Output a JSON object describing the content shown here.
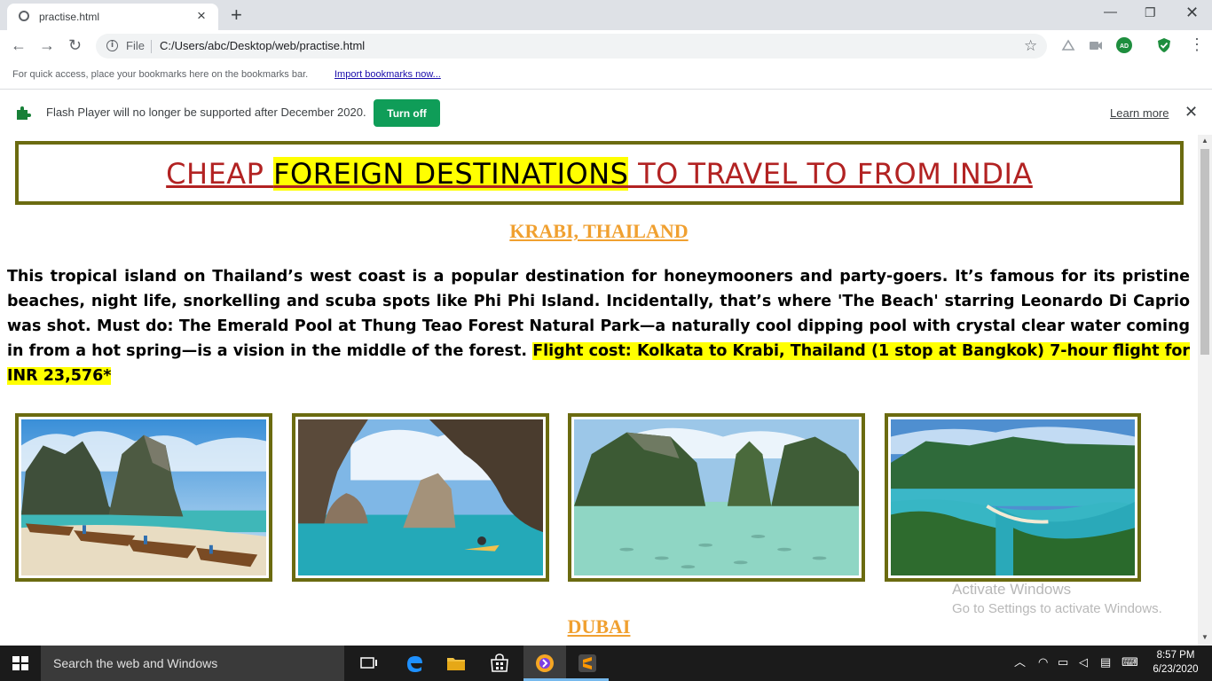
{
  "browser": {
    "tab_title": "practise.html",
    "file_label": "File",
    "url": "C:/Users/abc/Desktop/web/practise.html",
    "profile_initials": "AD",
    "bookmarks_hint": "For quick access, place your bookmarks here on the bookmarks bar.",
    "import_bookmarks": "Import bookmarks now...",
    "infobar": {
      "message": "Flash Player will no longer be supported after December 2020.",
      "turn_off": "Turn off",
      "learn_more": "Learn more"
    }
  },
  "page": {
    "heading_pre": "CHEAP ",
    "heading_highlight": "FOREIGN DESTINATIONS",
    "heading_post": " TO TRAVEL TO FROM INDIA",
    "section1_title": "KRABI, THAILAND",
    "section1_text": "This tropical island on Thailand’s west coast is a popular destination for honeymooners and party-goers. It’s famous for its pristine beaches, night life, snorkelling and scuba spots like Phi Phi Island. Incidentally, that’s where 'The Beach' starring Leonardo Di Caprio was shot. Must do: The Emerald Pool at Thung Teao Forest Natural Park—a naturally cool dipping pool with crystal clear water coming in from a hot spring—is a vision in the middle of the forest. ",
    "section1_highlight": "Flight cost: Kolkata to Krabi, Thailand (1 stop at Bangkok) 7-hour flight for INR 23,576*",
    "section2_title": "DUBAI"
  },
  "watermark": {
    "line1": "Activate Windows",
    "line2": "Go to Settings to activate Windows."
  },
  "taskbar": {
    "search_placeholder": "Search the web and Windows",
    "time": "8:57 PM",
    "date": "6/23/2020"
  },
  "colors": {
    "heading_red": "#b22222",
    "highlight": "#ffff00",
    "frame_olive": "#6b6b10",
    "subtitle_orange": "#f0a030",
    "turn_off_green": "#0f9d58"
  }
}
